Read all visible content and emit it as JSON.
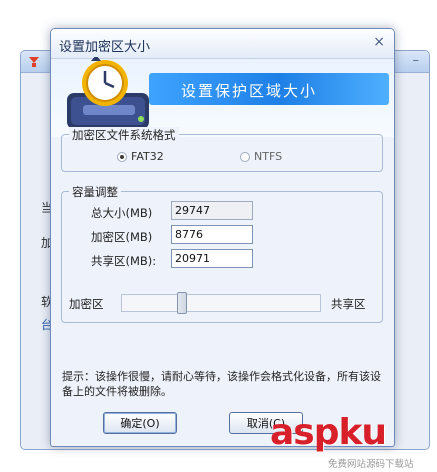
{
  "dialog": {
    "title": "设置加密区大小",
    "close_glyph": "×",
    "banner_text": "设置保护区域大小"
  },
  "filesystem": {
    "legend": "加密区文件系统格式",
    "options": [
      {
        "label": "FAT32",
        "selected": true
      },
      {
        "label": "NTFS",
        "selected": false
      }
    ]
  },
  "capacity": {
    "legend": "容量调整",
    "total_label": "总大小(MB)",
    "total_value": "29747",
    "encrypted_label": "加密区(MB)",
    "encrypted_value": "8776",
    "shared_label": "共享区(MB):",
    "shared_value": "20971"
  },
  "slider": {
    "left_label": "加密区",
    "right_label": "共享区",
    "position_fraction": 0.295
  },
  "hint": "提示：该操作很慢，请耐心等待，该操作会格式化设备，所有该设备上的文件将被删除。",
  "buttons": {
    "ok": "确定(O)",
    "cancel": "取消(C)"
  },
  "background_window": {
    "fragments": [
      "当",
      "加",
      "软",
      "台"
    ]
  },
  "watermark": {
    "main": "aspku",
    "sub": "免费网站源码下载站"
  },
  "colors": {
    "banner_strip": "#1e7fe6",
    "watermark": "#d8202a"
  }
}
